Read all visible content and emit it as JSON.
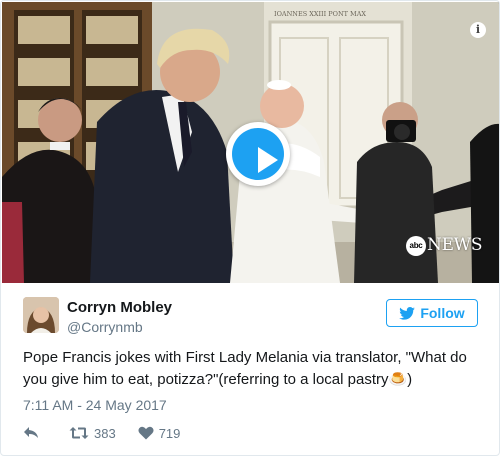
{
  "media": {
    "watermark_logo": "abc",
    "watermark_text": "NEWS",
    "inscription": "IOANNES XXIII PONT MAX"
  },
  "user": {
    "display_name": "Corryn Mobley",
    "handle": "@Corrynmb",
    "follow_label": "Follow"
  },
  "tweet": {
    "text": "Pope Francis jokes with First Lady Melania via translator, \"What do you give him to eat, potizza?\"(referring to a local pastry🍮)",
    "date": "7:11 AM - 24 May 2017"
  },
  "stats": {
    "retweets": "383",
    "likes": "719"
  },
  "colors": {
    "accent": "#1da1f2",
    "muted_text": "#657786",
    "border": "#e1e8ed"
  }
}
